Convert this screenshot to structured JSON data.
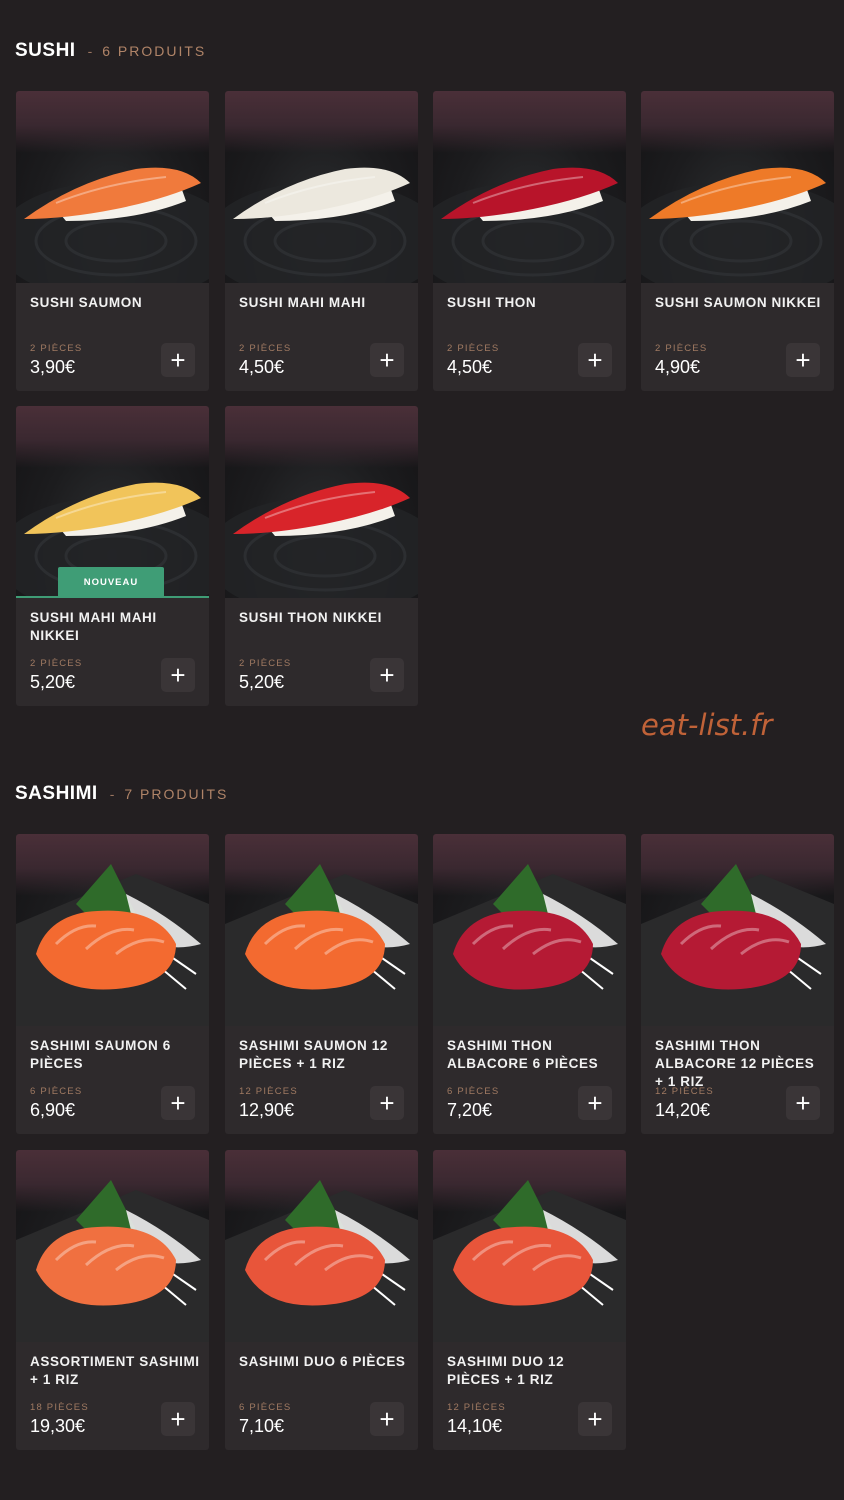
{
  "sections": [
    {
      "title": "SUSHI",
      "separator": "-",
      "count": "6 PRODUITS",
      "products": [
        {
          "name": "SUSHI SAUMON",
          "qty": "2 PIÈCES",
          "price": "3,90€",
          "fish": "#f07a3c",
          "badge": ""
        },
        {
          "name": "SUSHI MAHI MAHI",
          "qty": "2 PIÈCES",
          "price": "4,50€",
          "fish": "#ece8de",
          "badge": ""
        },
        {
          "name": "SUSHI THON",
          "qty": "2 PIÈCES",
          "price": "4,50€",
          "fish": "#b8142a",
          "badge": ""
        },
        {
          "name": "SUSHI SAUMON NIKKEI",
          "qty": "2 PIÈCES",
          "price": "4,90€",
          "fish": "#ee7a28",
          "badge": ""
        },
        {
          "name": "SUSHI MAHI MAHI NIKKEI",
          "qty": "2 PIÈCES",
          "price": "5,20€",
          "fish": "#f1c45a",
          "badge": "NOUVEAU"
        },
        {
          "name": "SUSHI THON NIKKEI",
          "qty": "2 PIÈCES",
          "price": "5,20€",
          "fish": "#d8242a",
          "badge": ""
        }
      ]
    },
    {
      "title": "SASHIMI",
      "separator": "-",
      "count": "7 PRODUITS",
      "products": [
        {
          "name": "SASHIMI SAUMON 6 PIÈCES",
          "qty": "6 PIÈCES",
          "price": "6,90€",
          "fish": "#f36a30",
          "badge": ""
        },
        {
          "name": "SASHIMI SAUMON 12 PIÈCES + 1 RIZ",
          "qty": "12 PIÈCES",
          "price": "12,90€",
          "fish": "#f36a30",
          "badge": ""
        },
        {
          "name": "SASHIMI THON ALBACORE 6 PIÈCES",
          "qty": "6 PIÈCES",
          "price": "7,20€",
          "fish": "#b51a34",
          "badge": ""
        },
        {
          "name": "SASHIMI THON ALBACORE 12 PIÈCES + 1 RIZ",
          "qty": "12 PIÈCES",
          "price": "14,20€",
          "fish": "#b51a34",
          "badge": ""
        },
        {
          "name": "ASSORTIMENT SASHIMI + 1 RIZ",
          "qty": "18 PIÈCES",
          "price": "19,30€",
          "fish": "#f07040",
          "badge": ""
        },
        {
          "name": "SASHIMI DUO 6 PIÈCES",
          "qty": "6 PIÈCES",
          "price": "7,10€",
          "fish": "#e8553a",
          "badge": ""
        },
        {
          "name": "SASHIMI DUO 12 PIÈCES + 1 RIZ",
          "qty": "12 PIÈCES",
          "price": "14,10€",
          "fish": "#e8553a",
          "badge": ""
        }
      ]
    }
  ],
  "add_icon": "plus-icon",
  "watermark": "eat-list.fr",
  "colors": {
    "background": "#231f21",
    "card": "#2e2a2c",
    "accent": "#b08468",
    "badge": "#3f9d76",
    "watermark": "#c06238"
  }
}
